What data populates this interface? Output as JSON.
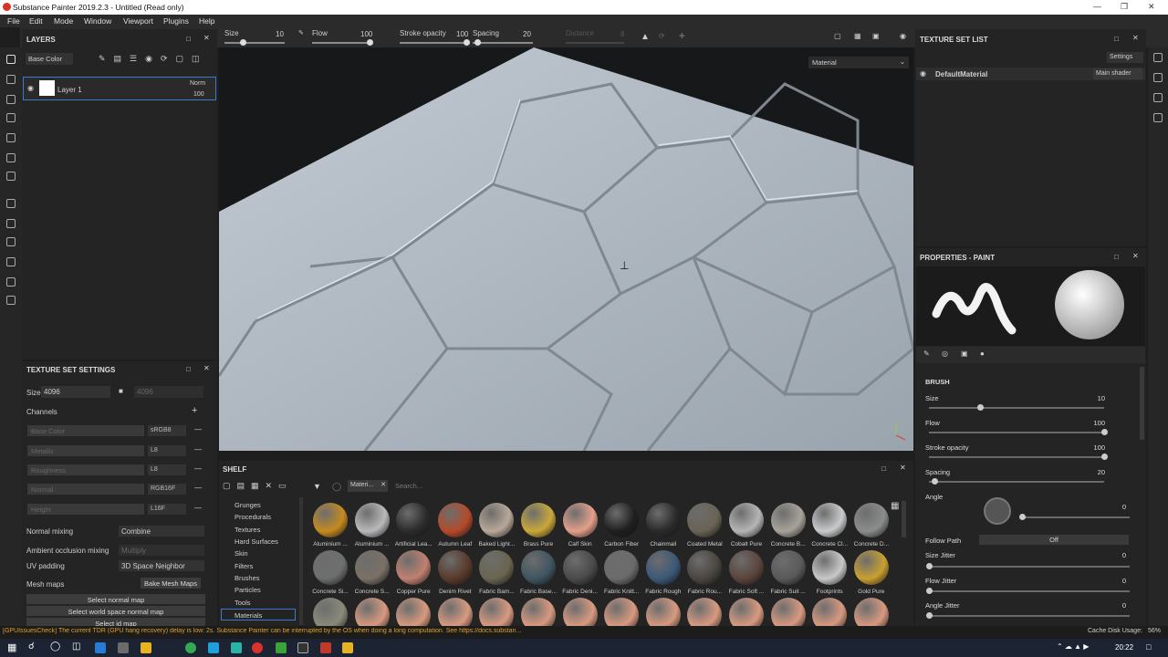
{
  "window": {
    "title": "Substance Painter 2019.2.3 - Untitled (Read only)"
  },
  "menu": [
    "File",
    "Edit",
    "Mode",
    "Window",
    "Viewport",
    "Plugins",
    "Help"
  ],
  "toolbar": {
    "size_label": "Size",
    "size_value": "10",
    "flow_label": "Flow",
    "flow_value": "100",
    "stroke_label": "Stroke opacity",
    "stroke_value": "100",
    "spacing_label": "Spacing",
    "spacing_value": "20",
    "distance_label": "Distance",
    "distance_value": "8"
  },
  "layers": {
    "title": "LAYERS",
    "channel": "Base Color",
    "layer_name": "Layer 1",
    "blend": "Norm",
    "opacity": "100"
  },
  "viewport": {
    "mode": "Material"
  },
  "tss": {
    "title": "TEXTURE SET SETTINGS",
    "size_label": "Size",
    "size_value": "4096",
    "size_locked": "4096",
    "channels_label": "Channels",
    "channels": [
      {
        "name": "Base Color",
        "fmt": "sRGB8"
      },
      {
        "name": "Metallic",
        "fmt": "L8"
      },
      {
        "name": "Roughness",
        "fmt": "L8"
      },
      {
        "name": "Normal",
        "fmt": "RGB16F"
      },
      {
        "name": "Height",
        "fmt": "L16F"
      }
    ],
    "normal_mixing_label": "Normal mixing",
    "normal_mixing": "Combine",
    "ao_label": "Ambient occlusion mixing",
    "ao_value": "Multiply",
    "uv_label": "UV padding",
    "uv_value": "3D Space Neighbor",
    "mesh_maps": "Mesh maps",
    "bake": "Bake Mesh Maps",
    "sel_normal": "Select normal map",
    "sel_world": "Select world space normal map",
    "sel_id": "Select id map"
  },
  "tsl": {
    "title": "TEXTURE SET LIST",
    "settings": "Settings",
    "material": "DefaultMaterial",
    "shader": "Main shader"
  },
  "props": {
    "title": "PROPERTIES - PAINT",
    "brush": "BRUSH",
    "size_label": "Size",
    "size": "10",
    "flow_label": "Flow",
    "flow": "100",
    "stroke_label": "Stroke opacity",
    "stroke": "100",
    "spacing_label": "Spacing",
    "spacing": "20",
    "angle_label": "Angle",
    "angle": "0",
    "follow_label": "Follow Path",
    "follow": "Off",
    "sizej_label": "Size Jitter",
    "sizej": "0",
    "flowj_label": "Flow Jitter",
    "flowj": "0",
    "anglej_label": "Angle Jitter",
    "anglej": "0"
  },
  "shelf": {
    "title": "SHELF",
    "filter_tag": "Materi...",
    "search_placeholder": "Search...",
    "categories": [
      "Grunges",
      "Procedurals",
      "Textures",
      "Hard Surfaces",
      "Skin",
      "Filters",
      "Brushes",
      "Particles",
      "Tools",
      "Materials"
    ],
    "row1": [
      "Aluminium ...",
      "Aluminium ...",
      "Artificial Lea...",
      "Autumn Leaf",
      "Baked Light...",
      "Brass Pure",
      "Calf Skin",
      "Carbon Fiber",
      "Chainmail",
      "Coated Metal",
      "Cobalt Pure",
      "Concrete B...",
      "Concrete Cl...",
      "Concrete D..."
    ],
    "row2": [
      "Concrete Si...",
      "Concrete S...",
      "Copper Pure",
      "Denim Rivet",
      "Fabric Bam...",
      "Fabric Base...",
      "Fabric Deni...",
      "Fabric Knitt...",
      "Fabric Rough",
      "Fabric Rou...",
      "Fabric Soft ...",
      "Fabric Suit ...",
      "Footprints",
      "Gold Pure"
    ],
    "colors1": [
      "#c58a20",
      "#b9b9bb",
      "#2b2b2b",
      "#b54a2a",
      "#b8a898",
      "#c9a83a",
      "#e3a08a",
      "#1f1f1f",
      "#2a2a2a",
      "#6a6356",
      "#b5b5b5",
      "#a8a39a",
      "#c9cbcc",
      "#8b8d8d"
    ],
    "colors2": [
      "#6d6e6e",
      "#7a7066",
      "#c08070",
      "#5a3a2a",
      "#6a6550",
      "#3f5560",
      "#4a4a4a",
      "#6b6b6b",
      "#3c5878",
      "#4a4540",
      "#5c443c",
      "#5a5a5a",
      "#c8c8c8",
      "#c9a030"
    ]
  },
  "status": {
    "message": "[GPUIssuesCheck] The current TDR (GPU hang recovery) delay is low: 2s. Substance Painter can be interrupted by the OS when doing a long computation. See https://docs.substan...",
    "cache": "Cache Disk Usage:",
    "cache_val": "56%"
  },
  "taskbar": {
    "time": "20:22"
  }
}
